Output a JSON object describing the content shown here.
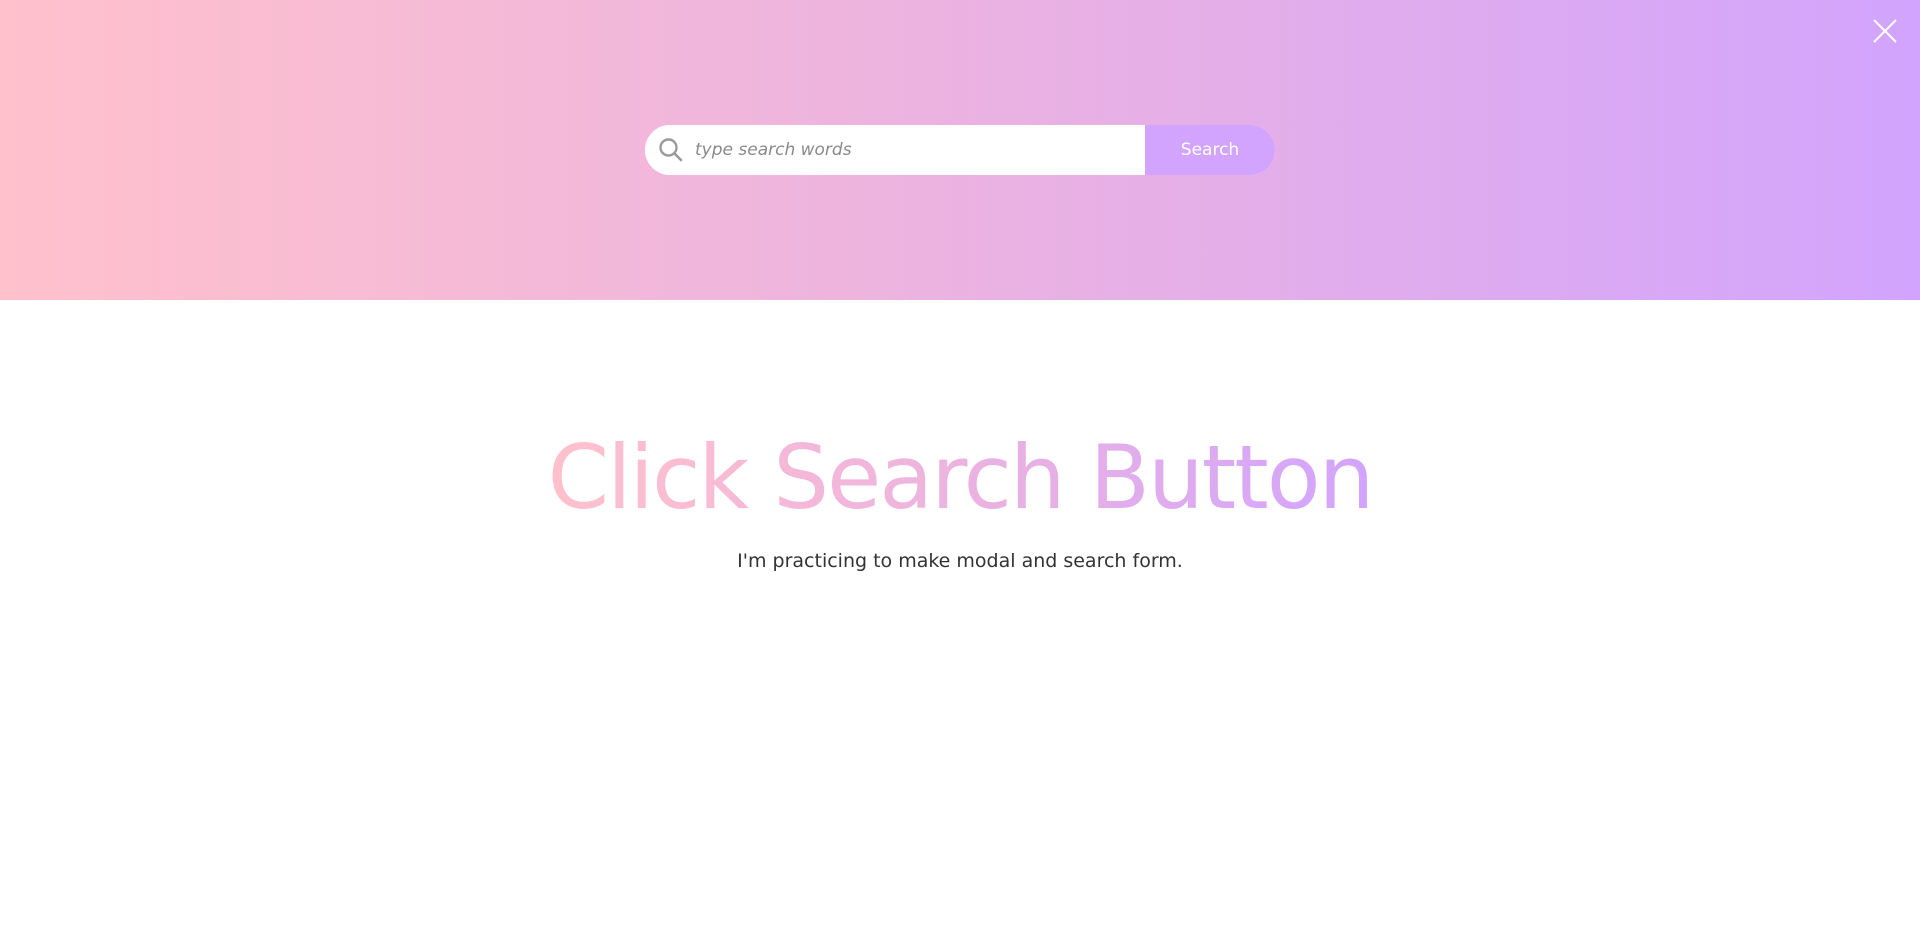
{
  "modal": {
    "close_label": "close",
    "search": {
      "placeholder": "type search words",
      "value": "",
      "button_label": "Search"
    },
    "gradient_start": "#ffc1cc",
    "gradient_end": "#d2a4fd"
  },
  "hero": {
    "title": "Click Search Button",
    "subtitle": "I'm practicing to make modal and search form."
  },
  "icons": {
    "search": "search-icon",
    "close": "close-icon"
  }
}
